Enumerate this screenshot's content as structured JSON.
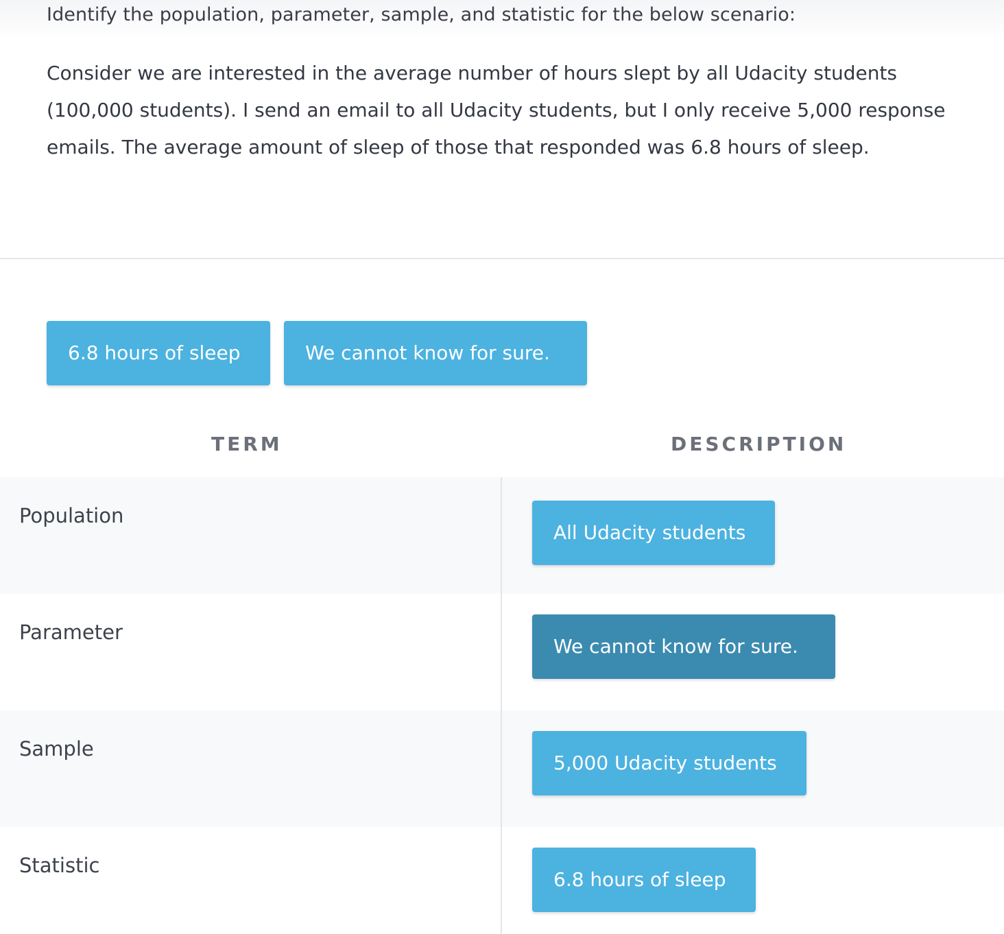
{
  "question": {
    "prompt": "Identify the population, parameter, sample, and statistic for the below scenario:",
    "scenario": "Consider we are interested in the average number of hours slept by all Udacity students (100,000 students). I send an email to all Udacity students, but I only receive 5,000 response emails. The average amount of sleep of those that responded was 6.8 hours of sleep."
  },
  "answer_bank": [
    {
      "label": "6.8 hours of sleep"
    },
    {
      "label": "We cannot know for sure."
    }
  ],
  "table": {
    "term_header": "TERM",
    "description_header": "DESCRIPTION",
    "rows": [
      {
        "term": "Population",
        "description": "All Udacity students"
      },
      {
        "term": "Parameter",
        "description": "We cannot know for sure."
      },
      {
        "term": "Sample",
        "description": "5,000 Udacity students"
      },
      {
        "term": "Statistic",
        "description": "6.8 hours of sleep"
      }
    ]
  },
  "colors": {
    "chip": "#4cb2e0",
    "chip_selected": "#3b8bb0",
    "row_shade": "#f8f9fb"
  }
}
